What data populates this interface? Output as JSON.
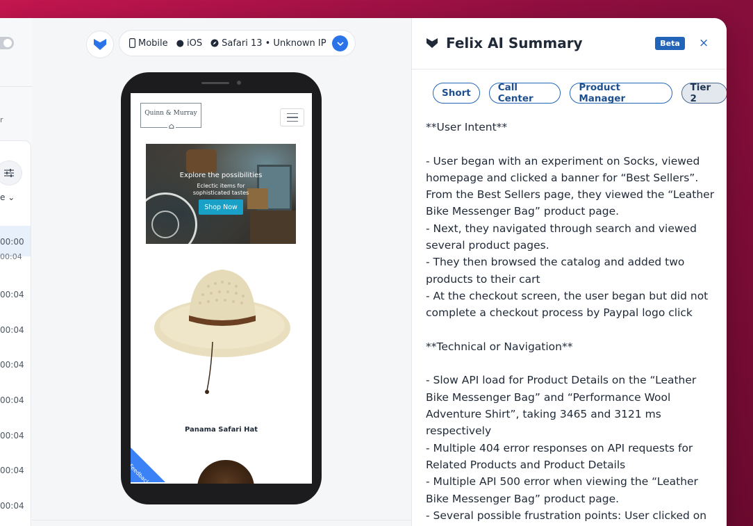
{
  "left": {
    "fragment": "r",
    "sort_fragment": "e",
    "times": [
      "00:00",
      "00:04",
      "00:04",
      "00:04",
      "00:04",
      "00:04",
      "00:04",
      "00:04",
      "00:04"
    ]
  },
  "header": {
    "device": "Mobile",
    "os": "iOS",
    "browser": "Safari 13 • Unknown IP"
  },
  "phone": {
    "brand": "Quinn & Murray",
    "banner_title": "Explore the possibilities",
    "banner_sub": "Eclectic items for sophisticated tastes",
    "shop_label": "Shop Now",
    "product_name": "Panama Safari Hat",
    "feedback_label": "Feedback"
  },
  "panel": {
    "title": "Felix AI Summary",
    "badge": "Beta",
    "close_label": "×",
    "chips": [
      {
        "label": "Short",
        "active": false
      },
      {
        "label": "Call Center",
        "active": false
      },
      {
        "label": "Product Manager",
        "active": false
      },
      {
        "label": "Tier 2",
        "active": true
      }
    ],
    "summary": {
      "h1": "**User Intent**",
      "p1": "- User began with an experiment on Socks, viewed homepage and clicked a banner for “Best Sellers”. From the Best Sellers page, they viewed the “Leather Bike Messenger Bag” product page.",
      "p2": "- Next, they navigated through search and viewed several product pages.",
      "p3": "- They then browsed the catalog and added two products to their cart",
      "p4": "- At the checkout screen, the user began but did not complete a checkout process by Paypal logo click",
      "h2": "**Technical or Navigation**",
      "p5": "- Slow API load for Product Details on the “Leather Bike Messenger Bag” and “Performance Wool Adventure Shirt”, taking 3465 and 3121 ms respectively",
      "p6": "- Multiple 404 error responses on API requests for Related Products and Product Details",
      "p7": "- Multiple API 500 error when viewing the “Leather Bike Messenger Bag” product page.",
      "p8": "- Several possible frustration points: User clicked on"
    }
  },
  "colors": {
    "accent": "#2264b8",
    "brand_bg": "#c3164f",
    "shop_button": "#18a0c6"
  }
}
